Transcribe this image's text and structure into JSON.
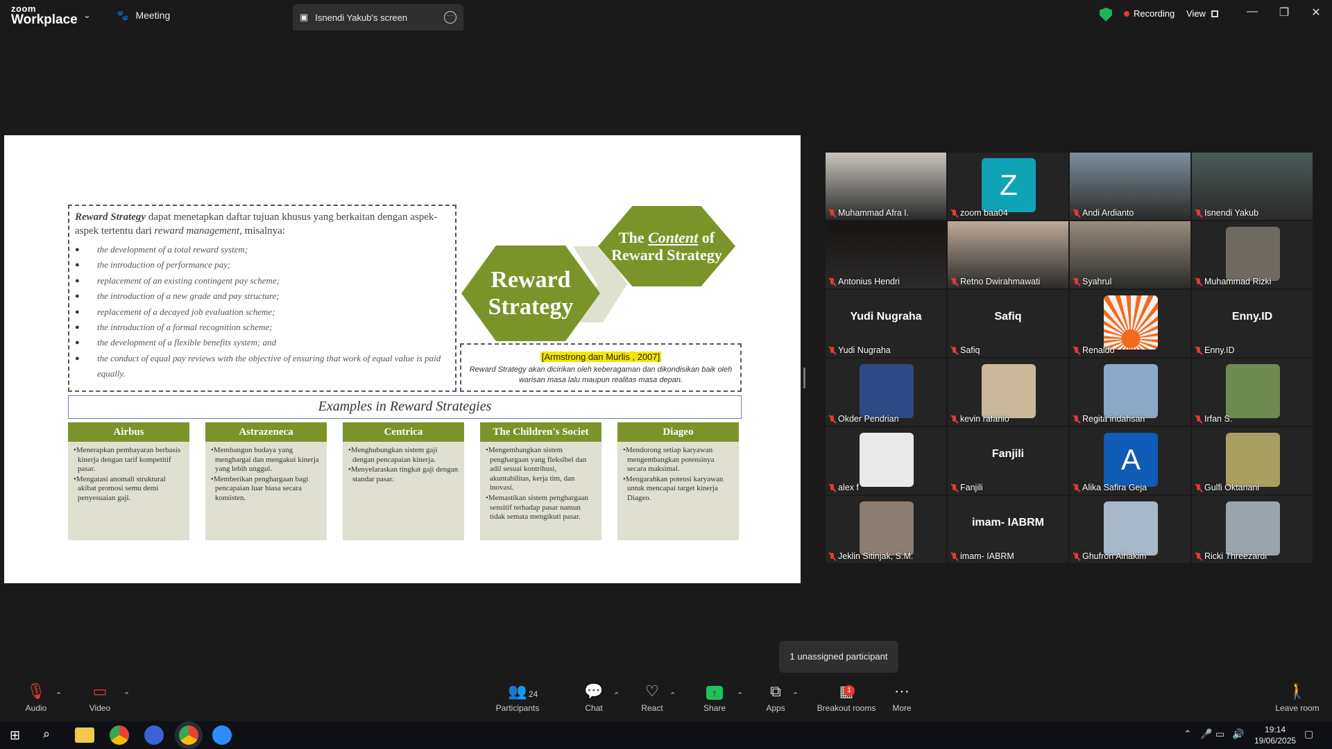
{
  "titlebar": {
    "logo_line1": "zoom",
    "logo_line2": "Workplace",
    "meeting_tab": "Meeting",
    "screen_tab": "Isnendi Yakub's screen",
    "recording": "Recording",
    "view": "View"
  },
  "slide": {
    "intro_term": "Reward Strategy",
    "intro_rest": " dapat menetapkan daftar tujuan khusus yang berkaitan dengan aspek-aspek tertentu dari ",
    "intro_term2": "reward management",
    "intro_end": ", misalnya:",
    "bullets": [
      "the development of a total reward system;",
      "the introduction of performance pay;",
      "replacement of an existing contingent pay scheme;",
      "the introduction of a new grade and pay structure;",
      "replacement of a decayed job evaluation scheme;",
      "the introduction of a formal recognition scheme;",
      "the development of a flexible benefits system; and",
      "the conduct of equal pay reviews with the objective of ensuring that work of equal value is paid equally."
    ],
    "hex_main": "Reward Strategy",
    "hex_small_1": "The ",
    "hex_small_content": "Content",
    "hex_small_2": " of Reward Strategy",
    "citation": "[Armstrong dan Murlis , 2007]",
    "citation_desc": "Reward Strategy akan dicirikan oleh keberagaman dan dikondisikan baik oleh warisan masa lalu maupun realitas masa depan.",
    "examples_title": "Examples in Reward Strategies",
    "columns": [
      {
        "head": "Airbus",
        "items": [
          "•Menerapkan pembayaran berbasis kinerja dengan tarif kompetitif pasar.",
          "•Mengatasi anomali struktural akibat promosi semu demi penyesuaian gaji."
        ]
      },
      {
        "head": "Astrazeneca",
        "items": [
          "•Membangun budaya yang menghargai dan mengakui kinerja yang lebih unggul.",
          "•Memberikan penghargaan bagi pencapaian luar biasa secara konsisten."
        ]
      },
      {
        "head": "Centrica",
        "items": [
          "•Menghubungkan sistem gaji dengan pencapaian kinerja.",
          "•Menyelaraskan tingkat gaji dengan standar pasar."
        ]
      },
      {
        "head": "The Children's Societ",
        "items": [
          "•Mengembangkan sistem penghargaan yang fleksibel dan adil sesuai kontribusi, akuntabilitas, kerja tim, dan inovasi.",
          "•Memastikan sistem penghargaan sensitif terhadap pasar namun tidak semata mengikuti pasar."
        ]
      },
      {
        "head": "Diageo",
        "items": [
          "•Mendorong setiap karyawan mengembangkan potensinya secara maksimal.",
          "•Mengarahkan potensi karyawan untuk mencapai target kinerja Diageo."
        ]
      }
    ]
  },
  "participants": [
    {
      "name": "Muhammad Afra I.",
      "kind": "video",
      "bg": "#c9c4bd"
    },
    {
      "name": "zoom baa04",
      "kind": "avatar",
      "letter": "Z",
      "color": "#10a3b5"
    },
    {
      "name": "Andi Ardianto",
      "kind": "video",
      "bg": "#7d8f9c"
    },
    {
      "name": "Isnendi Yakub",
      "kind": "video",
      "bg": "#4a5a58",
      "active": true
    },
    {
      "name": "Antonius Hendri",
      "kind": "video",
      "bg": "#1a1414"
    },
    {
      "name": "Retno Dwirahmawati",
      "kind": "video",
      "bg": "#bca99a"
    },
    {
      "name": "Syahrul",
      "kind": "video",
      "bg": "#9a8c7e"
    },
    {
      "name": "Muhammad Rizki",
      "kind": "avatar",
      "letter": "",
      "color": "#6f6a60"
    },
    {
      "name": "Yudi  Nugraha",
      "kind": "text",
      "center": "Yudi  Nugraha"
    },
    {
      "name": "Safiq",
      "kind": "text",
      "center": "Safiq"
    },
    {
      "name": "Renaldo",
      "kind": "avatar",
      "letter": "",
      "color": "#f4f1ee",
      "sun": true
    },
    {
      "name": "Enny.ID",
      "kind": "text",
      "center": "Enny.ID"
    },
    {
      "name": "Okder Pendrian",
      "kind": "avatar",
      "letter": "",
      "color": "#2c4a86"
    },
    {
      "name": "kevin rafanio",
      "kind": "avatar",
      "letter": "",
      "color": "#c9b99a"
    },
    {
      "name": "Regita indahsari",
      "kind": "avatar",
      "letter": "",
      "color": "#8aa8c7"
    },
    {
      "name": "Irfan S.",
      "kind": "avatar",
      "letter": "",
      "color": "#6f8a4e"
    },
    {
      "name": "alex  f",
      "kind": "avatar",
      "letter": "",
      "color": "#e9e9e9"
    },
    {
      "name": "Fanjili",
      "kind": "text",
      "center": "Fanjili"
    },
    {
      "name": "Alika Safira Geja",
      "kind": "avatar",
      "letter": "A",
      "color": "#0f5bb5"
    },
    {
      "name": "Gulfi Oktariani",
      "kind": "avatar",
      "letter": "",
      "color": "#a7a060"
    },
    {
      "name": "Jeklin Sitinjak, S.M.",
      "kind": "avatar",
      "letter": "",
      "color": "#8c7d73"
    },
    {
      "name": "imam- IABRM",
      "kind": "text",
      "center": "imam- IABRM"
    },
    {
      "name": "Ghufron Alhakim",
      "kind": "avatar",
      "letter": "",
      "color": "#a9b8c8"
    },
    {
      "name": "Ricki Threezardi",
      "kind": "avatar",
      "letter": "",
      "color": "#9aa4ad"
    }
  ],
  "tooltip": "1 unassigned participant",
  "toolbar": {
    "audio": "Audio",
    "video": "Video",
    "participants": "Participants",
    "participants_count": "24",
    "chat": "Chat",
    "react": "React",
    "share": "Share",
    "apps": "Apps",
    "breakout": "Breakout rooms",
    "breakout_badge": "1",
    "more": "More",
    "leave": "Leave room"
  },
  "taskbar": {
    "time": "19:14",
    "date": "19/06/2025"
  }
}
